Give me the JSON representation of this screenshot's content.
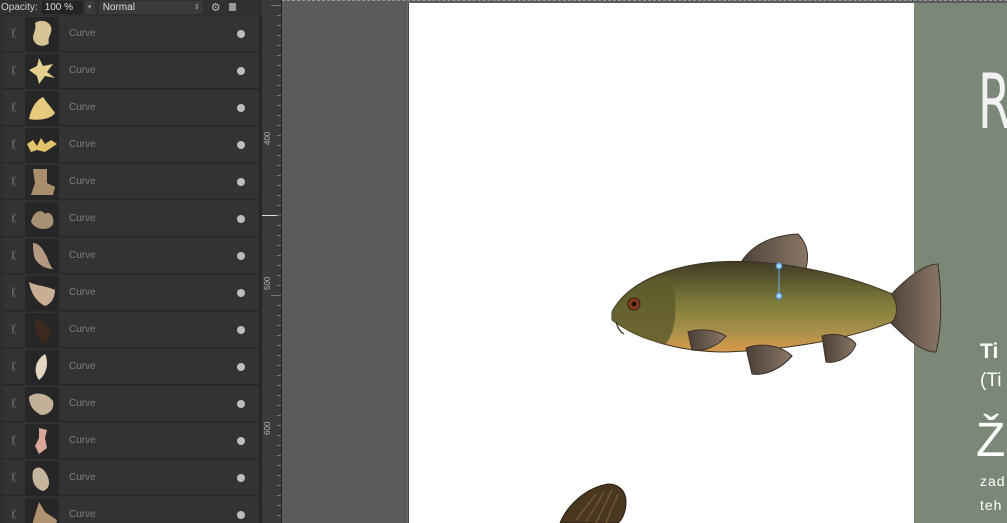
{
  "toolbar": {
    "opacity_label": "Opacity:",
    "opacity_value": "100 %",
    "blend_mode": "Normal",
    "gear_icon": "gear-icon",
    "lock_icon": "lock-icon"
  },
  "layers": [
    {
      "name": "Curve",
      "color": "#d6c494",
      "shape": "blob1"
    },
    {
      "name": "Curve",
      "color": "#e4cf8e",
      "shape": "star"
    },
    {
      "name": "Curve",
      "color": "#e7ca7e",
      "shape": "blob2"
    },
    {
      "name": "Curve",
      "color": "#e2c36a",
      "shape": "spiky"
    },
    {
      "name": "Curve",
      "color": "#a88e6c",
      "shape": "boot"
    },
    {
      "name": "Curve",
      "color": "#a69174",
      "shape": "blob3"
    },
    {
      "name": "Curve",
      "color": "#b39a80",
      "shape": "fin"
    },
    {
      "name": "Curve",
      "color": "#c8ae92",
      "shape": "fan"
    },
    {
      "name": "Curve",
      "color": "#3c2a1e",
      "shape": "dark"
    },
    {
      "name": "Curve",
      "color": "#e2d6c2",
      "shape": "leaf"
    },
    {
      "name": "Curve",
      "color": "#c2b198",
      "shape": "oval"
    },
    {
      "name": "Curve",
      "color": "#d9a79a",
      "shape": "pinkfin"
    },
    {
      "name": "Curve",
      "color": "#c6b69e",
      "shape": "leaf2"
    },
    {
      "name": "Curve",
      "color": "#b09170",
      "shape": "tri"
    }
  ],
  "ruler": {
    "labels": [
      "400",
      "500",
      "600"
    ]
  },
  "document": {
    "big_letter": "R",
    "title_bold": "Ti",
    "subtitle": "(Ti",
    "big_char": "Ž",
    "line1": "zad",
    "line2": "teh"
  },
  "colors": {
    "panel_bg": "#2e2e2e",
    "canvas_bg": "#5b5b5b",
    "page_bg": "#ffffff",
    "side_panel": "#7b8878"
  }
}
